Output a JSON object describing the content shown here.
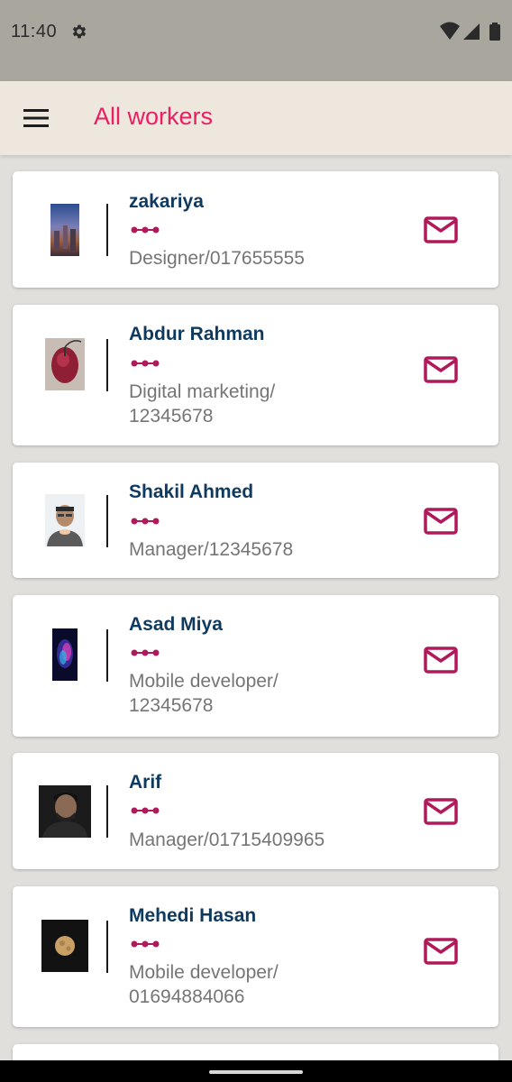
{
  "status_bar": {
    "time": "11:40",
    "settings_icon": "gear-icon",
    "wifi_icon": "wifi-icon",
    "signal_icon": "signal-icon",
    "battery_icon": "battery-icon"
  },
  "app_bar": {
    "title": "All workers",
    "menu_icon": "hamburger-menu-icon"
  },
  "colors": {
    "accent": "#e91e63",
    "mail_icon": "#b0195a",
    "name_text": "#0f3a5f",
    "role_text": "#757575",
    "app_bar_bg": "#eee7de",
    "status_bar_bg": "#a9a69e"
  },
  "workers": [
    {
      "name": "zakariya",
      "role": "Designer/017655555"
    },
    {
      "name": "Abdur Rahman",
      "role": "Digital marketing/ 12345678"
    },
    {
      "name": "Shakil Ahmed",
      "role": "Manager/12345678"
    },
    {
      "name": "Asad Miya",
      "role": "Mobile developer/ 12345678"
    },
    {
      "name": "Arif",
      "role": "Manager/01715409965"
    },
    {
      "name": "Mehedi Hasan",
      "role": "Mobile developer/ 01694884066"
    }
  ]
}
